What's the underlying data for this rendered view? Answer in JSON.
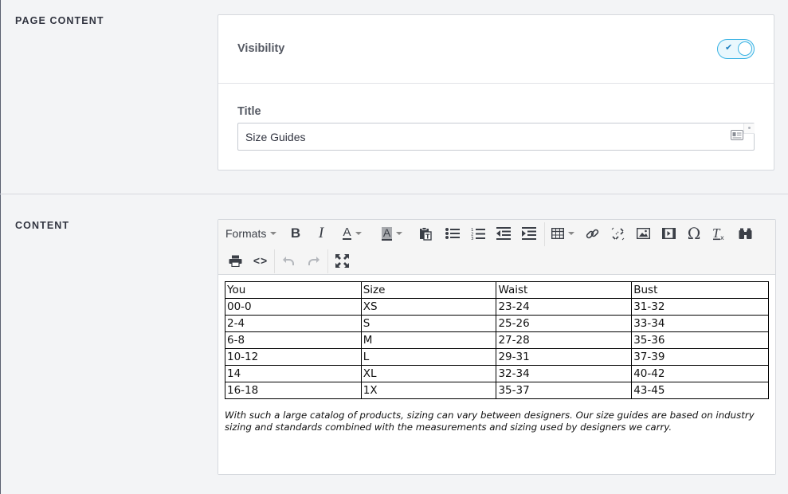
{
  "sections": {
    "page_content_label": "PAGE CONTENT",
    "content_label": "CONTENT"
  },
  "page_content": {
    "visibility_label": "Visibility",
    "visibility_on": true,
    "title_label": "Title",
    "title_value": "Size Guides"
  },
  "toolbar": {
    "formats_label": "Formats",
    "row1_icons": [
      "bold-icon",
      "italic-icon",
      "text-color-icon",
      "background-color-icon",
      "paste-as-text-icon",
      "bullet-list-icon",
      "numbered-list-icon",
      "outdent-icon",
      "indent-icon",
      "table-icon",
      "link-icon",
      "unlink-icon",
      "image-icon",
      "media-icon",
      "special-character-icon",
      "clear-formatting-icon",
      "find-replace-icon"
    ],
    "row2_icons": [
      "print-icon",
      "source-code-icon",
      "undo-icon",
      "redo-icon",
      "fullscreen-icon"
    ]
  },
  "table": {
    "rows": [
      [
        "You",
        "Size",
        "Waist",
        "Bust"
      ],
      [
        "00-0",
        "XS",
        "23-24",
        "31-32"
      ],
      [
        "2-4",
        "S",
        "25-26",
        "33-34"
      ],
      [
        "6-8",
        "M",
        "27-28",
        "35-36"
      ],
      [
        "10-12",
        "L",
        "29-31",
        "37-39"
      ],
      [
        "14",
        "XL",
        "32-34",
        "40-42"
      ],
      [
        "16-18",
        "1X",
        "35-37",
        "43-45"
      ]
    ]
  },
  "note": "With such a large catalog of products, sizing can vary between designers. Our size guides are based on industry sizing and standards combined with the measurements and sizing used by designers we carry.",
  "colors": {
    "toggle_accent": "#3ab3e4",
    "background": "#f3f4f6"
  }
}
